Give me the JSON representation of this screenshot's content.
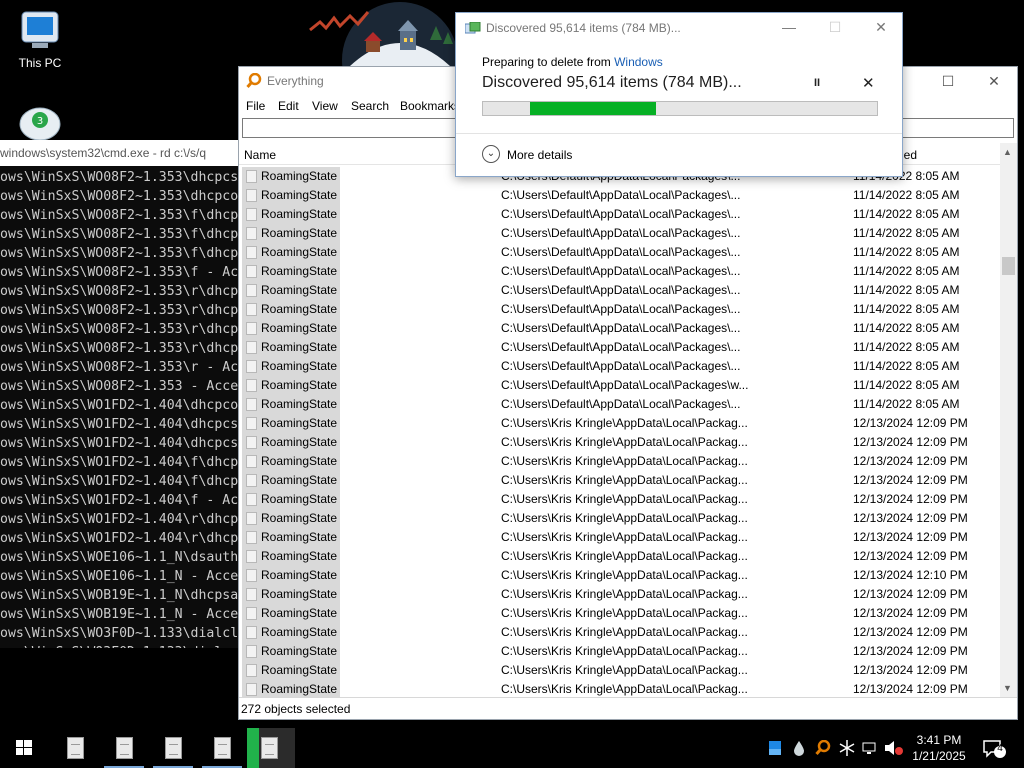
{
  "desktop": {
    "icons": [
      {
        "label": "This PC",
        "icon": "this-pc-icon"
      },
      {
        "label": "",
        "icon": "recycle-bin-icon"
      }
    ]
  },
  "cmd": {
    "title": "windows\\system32\\cmd.exe - rd  c:\\/s/q",
    "lines": [
      "ows\\WinSxS\\WO08F2~1.353\\dhcpcs",
      "ows\\WinSxS\\WO08F2~1.353\\dhcpco",
      "ows\\WinSxS\\WO08F2~1.353\\f\\dhcp",
      "ows\\WinSxS\\WO08F2~1.353\\f\\dhcp",
      "ows\\WinSxS\\WO08F2~1.353\\f\\dhcp",
      "ows\\WinSxS\\WO08F2~1.353\\f - Ac",
      "ows\\WinSxS\\WO08F2~1.353\\r\\dhcp",
      "ows\\WinSxS\\WO08F2~1.353\\r\\dhcp",
      "ows\\WinSxS\\WO08F2~1.353\\r\\dhcp",
      "ows\\WinSxS\\WO08F2~1.353\\r\\dhcp",
      "ows\\WinSxS\\WO08F2~1.353\\r - Ac",
      "ows\\WinSxS\\WO08F2~1.353 - Acce",
      "ows\\WinSxS\\WO1FD2~1.404\\dhcpco",
      "ows\\WinSxS\\WO1FD2~1.404\\dhcpcs",
      "ows\\WinSxS\\WO1FD2~1.404\\dhcpcs",
      "ows\\WinSxS\\WO1FD2~1.404\\f\\dhcp",
      "ows\\WinSxS\\WO1FD2~1.404\\f\\dhcp",
      "ows\\WinSxS\\WO1FD2~1.404\\f - Ac",
      "ows\\WinSxS\\WO1FD2~1.404\\r\\dhcp",
      "ows\\WinSxS\\WO1FD2~1.404\\r\\dhcp",
      "ows\\WinSxS\\WOE106~1.1_N\\dsauth",
      "ows\\WinSxS\\WOE106~1.1_N - Acce",
      "ows\\WinSxS\\WOB19E~1.1_N\\dhcpsa",
      "ows\\WinSxS\\WOB19E~1.1_N - Acce",
      "ows\\WinSxS\\WO3F0D~1.133\\dialcl",
      "ows\\WinSxS\\WO3F0D~1.133\\dial",
      "ows\\WinSxS\\WO3F0D~1.133\\f - Ac"
    ]
  },
  "everything": {
    "title": "Everything",
    "menu": [
      "File",
      "Edit",
      "View",
      "Search",
      "Bookmarks"
    ],
    "search_value": "",
    "columns": {
      "name": "Name",
      "date": "ied"
    },
    "rows": [
      {
        "name": "RoamingState",
        "path": "C:\\Users\\Default\\AppData\\Local\\Packages\\...",
        "date": "11/14/2022 8:05 AM"
      },
      {
        "name": "RoamingState",
        "path": "C:\\Users\\Default\\AppData\\Local\\Packages\\...",
        "date": "11/14/2022 8:05 AM"
      },
      {
        "name": "RoamingState",
        "path": "C:\\Users\\Default\\AppData\\Local\\Packages\\...",
        "date": "11/14/2022 8:05 AM"
      },
      {
        "name": "RoamingState",
        "path": "C:\\Users\\Default\\AppData\\Local\\Packages\\...",
        "date": "11/14/2022 8:05 AM"
      },
      {
        "name": "RoamingState",
        "path": "C:\\Users\\Default\\AppData\\Local\\Packages\\...",
        "date": "11/14/2022 8:05 AM"
      },
      {
        "name": "RoamingState",
        "path": "C:\\Users\\Default\\AppData\\Local\\Packages\\...",
        "date": "11/14/2022 8:05 AM"
      },
      {
        "name": "RoamingState",
        "path": "C:\\Users\\Default\\AppData\\Local\\Packages\\...",
        "date": "11/14/2022 8:05 AM"
      },
      {
        "name": "RoamingState",
        "path": "C:\\Users\\Default\\AppData\\Local\\Packages\\...",
        "date": "11/14/2022 8:05 AM"
      },
      {
        "name": "RoamingState",
        "path": "C:\\Users\\Default\\AppData\\Local\\Packages\\...",
        "date": "11/14/2022 8:05 AM"
      },
      {
        "name": "RoamingState",
        "path": "C:\\Users\\Default\\AppData\\Local\\Packages\\...",
        "date": "11/14/2022 8:05 AM"
      },
      {
        "name": "RoamingState",
        "path": "C:\\Users\\Default\\AppData\\Local\\Packages\\...",
        "date": "11/14/2022 8:05 AM"
      },
      {
        "name": "RoamingState",
        "path": "C:\\Users\\Default\\AppData\\Local\\Packages\\w...",
        "date": "11/14/2022 8:05 AM"
      },
      {
        "name": "RoamingState",
        "path": "C:\\Users\\Default\\AppData\\Local\\Packages\\...",
        "date": "11/14/2022 8:05 AM"
      },
      {
        "name": "RoamingState",
        "path": "C:\\Users\\Kris Kringle\\AppData\\Local\\Packag...",
        "date": "12/13/2024 12:09 PM"
      },
      {
        "name": "RoamingState",
        "path": "C:\\Users\\Kris Kringle\\AppData\\Local\\Packag...",
        "date": "12/13/2024 12:09 PM"
      },
      {
        "name": "RoamingState",
        "path": "C:\\Users\\Kris Kringle\\AppData\\Local\\Packag...",
        "date": "12/13/2024 12:09 PM"
      },
      {
        "name": "RoamingState",
        "path": "C:\\Users\\Kris Kringle\\AppData\\Local\\Packag...",
        "date": "12/13/2024 12:09 PM"
      },
      {
        "name": "RoamingState",
        "path": "C:\\Users\\Kris Kringle\\AppData\\Local\\Packag...",
        "date": "12/13/2024 12:09 PM"
      },
      {
        "name": "RoamingState",
        "path": "C:\\Users\\Kris Kringle\\AppData\\Local\\Packag...",
        "date": "12/13/2024 12:09 PM"
      },
      {
        "name": "RoamingState",
        "path": "C:\\Users\\Kris Kringle\\AppData\\Local\\Packag...",
        "date": "12/13/2024 12:09 PM"
      },
      {
        "name": "RoamingState",
        "path": "C:\\Users\\Kris Kringle\\AppData\\Local\\Packag...",
        "date": "12/13/2024 12:09 PM"
      },
      {
        "name": "RoamingState",
        "path": "C:\\Users\\Kris Kringle\\AppData\\Local\\Packag...",
        "date": "12/13/2024 12:10 PM"
      },
      {
        "name": "RoamingState",
        "path": "C:\\Users\\Kris Kringle\\AppData\\Local\\Packag...",
        "date": "12/13/2024 12:09 PM"
      },
      {
        "name": "RoamingState",
        "path": "C:\\Users\\Kris Kringle\\AppData\\Local\\Packag...",
        "date": "12/13/2024 12:09 PM"
      },
      {
        "name": "RoamingState",
        "path": "C:\\Users\\Kris Kringle\\AppData\\Local\\Packag...",
        "date": "12/13/2024 12:09 PM"
      },
      {
        "name": "RoamingState",
        "path": "C:\\Users\\Kris Kringle\\AppData\\Local\\Packag...",
        "date": "12/13/2024 12:09 PM"
      },
      {
        "name": "RoamingState",
        "path": "C:\\Users\\Kris Kringle\\AppData\\Local\\Packag...",
        "date": "12/13/2024 12:09 PM"
      },
      {
        "name": "RoamingState",
        "path": "C:\\Users\\Kris Kringle\\AppData\\Local\\Packag...",
        "date": "12/13/2024 12:09 PM"
      }
    ],
    "status": "272 objects selected"
  },
  "dialog": {
    "title": "Discovered 95,614 items (784 MB)...",
    "prep_prefix": "Preparing to delete from ",
    "prep_link": "Windows",
    "main_text": "Discovered 95,614 items (784 MB)...",
    "progress_start": 0.12,
    "progress_end": 0.44,
    "pause_glyph": "II",
    "cancel_glyph": "✕",
    "more_details": "More details"
  },
  "taskbar": {
    "clock_time": "3:41 PM",
    "clock_date": "1/21/2025",
    "notification_count": "4"
  },
  "colors": {
    "progress_fill": "#06b025",
    "link": "#1a5fb4",
    "active_app": "#21b24b"
  }
}
